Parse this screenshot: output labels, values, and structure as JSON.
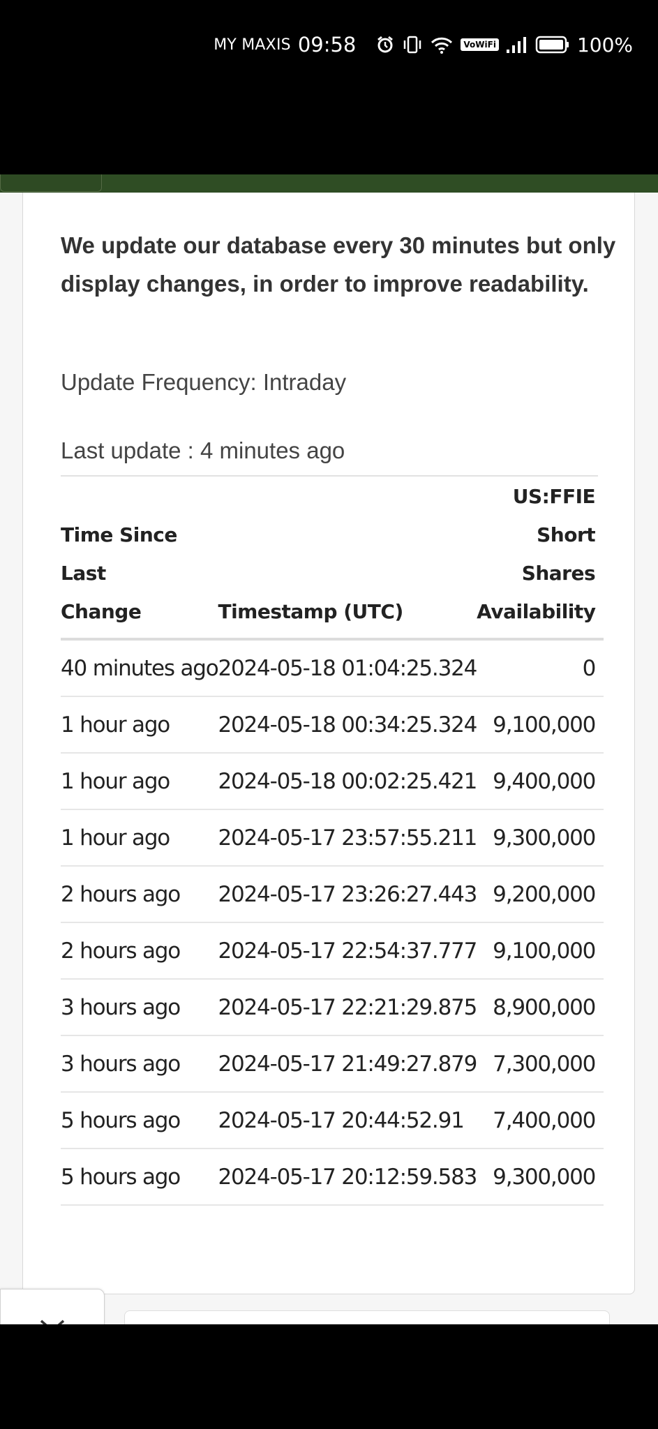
{
  "status_bar": {
    "carrier": "MY MAXIS",
    "time": "09:58",
    "vowifi_label": "VoWiFi",
    "battery_pct": "100%",
    "icons": [
      "alarm-icon",
      "vibrate-icon",
      "wifi-6-icon",
      "vowifi-icon",
      "signal-icon",
      "battery-icon"
    ]
  },
  "info": {
    "description": "We update our database every 30 minutes but only display changes, in order to improve readability.",
    "update_frequency": "Update Frequency: Intraday",
    "last_update": "Last update : 4 minutes ago"
  },
  "table": {
    "headers": {
      "since": "Time Since Last Change",
      "timestamp": "Timestamp (UTC)",
      "availability": "US:FFIE Short Shares Availability"
    },
    "rows": [
      {
        "since": "40 minutes ago",
        "timestamp": "2024-05-18 01:04:25.324",
        "value": "0"
      },
      {
        "since": "1 hour ago",
        "timestamp": "2024-05-18 00:34:25.324",
        "value": "9,100,000"
      },
      {
        "since": "1 hour ago",
        "timestamp": "2024-05-18 00:02:25.421",
        "value": "9,400,000"
      },
      {
        "since": "1 hour ago",
        "timestamp": "2024-05-17 23:57:55.211",
        "value": "9,300,000"
      },
      {
        "since": "2 hours ago",
        "timestamp": "2024-05-17 23:26:27.443",
        "value": "9,200,000"
      },
      {
        "since": "2 hours ago",
        "timestamp": "2024-05-17 22:54:37.777",
        "value": "9,100,000"
      },
      {
        "since": "3 hours ago",
        "timestamp": "2024-05-17 22:21:29.875",
        "value": "8,900,000"
      },
      {
        "since": "3 hours ago",
        "timestamp": "2024-05-17 21:49:27.879",
        "value": "7,300,000"
      },
      {
        "since": "5 hours ago",
        "timestamp": "2024-05-17 20:44:52.91",
        "value": "7,400,000"
      },
      {
        "since": "5 hours ago",
        "timestamp": "2024-05-17 20:12:59.583",
        "value": "9,300,000"
      }
    ]
  },
  "colors": {
    "header_green": "#2f4d24",
    "text": "#222222",
    "page_bg": "#f6f6f6"
  }
}
